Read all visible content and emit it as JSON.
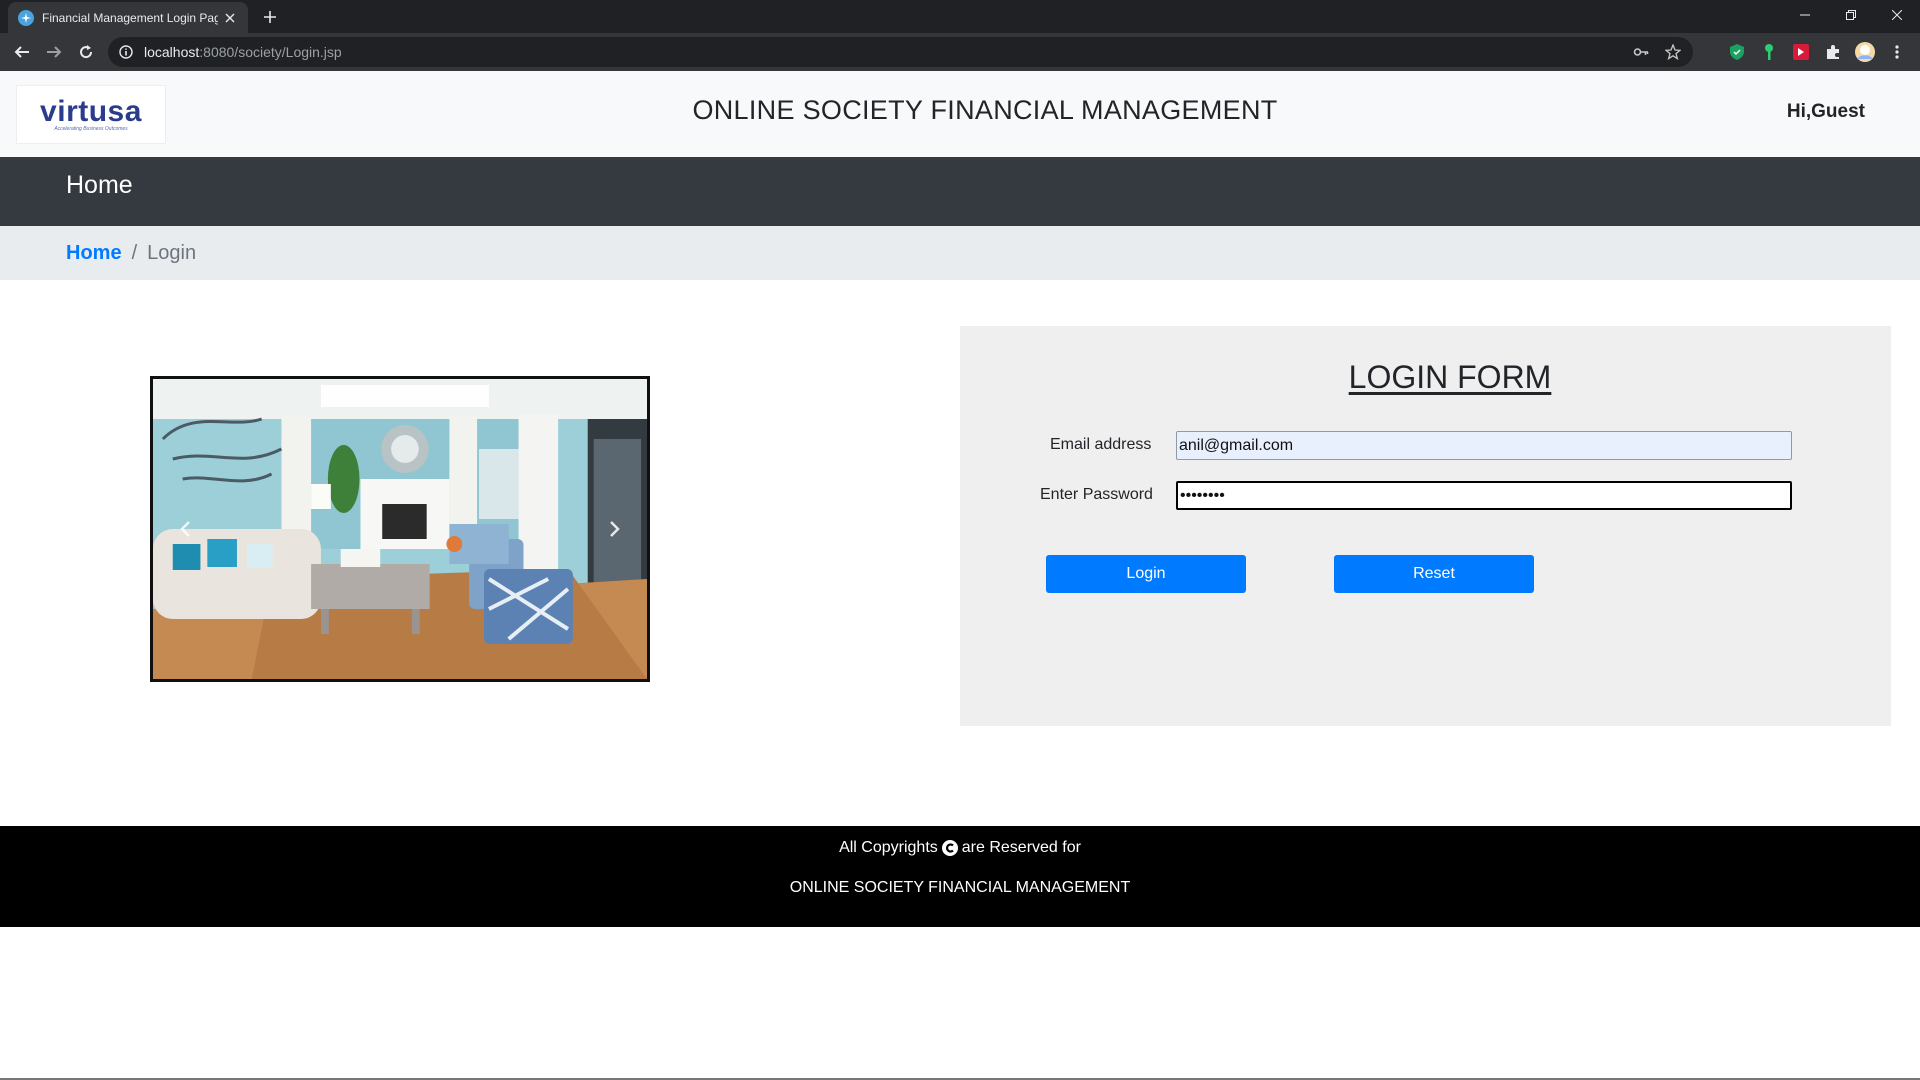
{
  "browser": {
    "tab_title": "Financial Management Login Page",
    "url_host": "localhost",
    "url_rest": ":8080/society/Login.jsp"
  },
  "header": {
    "logo_word": "virtusa",
    "logo_tagline": "Accelerating Business Outcomes",
    "site_title": "ONLINE SOCIETY FINANCIAL MANAGEMENT",
    "greeting": "Hi,Guest"
  },
  "navbar": {
    "home_label": "Home"
  },
  "breadcrumb": {
    "home": "Home",
    "separator": "/",
    "current": "Login"
  },
  "login_form": {
    "title": "LOGIN FORM",
    "email_label": "Email address",
    "email_value": "anil@gmail.com",
    "password_label": "Enter Password",
    "password_value": "••••••••",
    "login_button": "Login",
    "reset_button": "Reset"
  },
  "footer": {
    "line1_before": "All Copyrights",
    "line1_after": "are Reserved for",
    "line2": "ONLINE SOCIETY FINANCIAL MANAGEMENT"
  },
  "colors": {
    "navbar_bg": "#343a40",
    "primary": "#007bff",
    "breadcrumb_bg": "#e9ecef",
    "footer_bg": "#000000"
  }
}
